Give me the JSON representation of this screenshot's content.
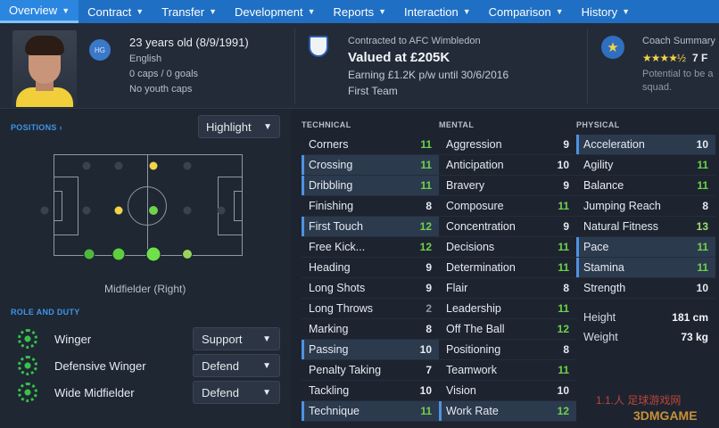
{
  "nav": [
    {
      "label": "Overview",
      "active": true
    },
    {
      "label": "Contract"
    },
    {
      "label": "Transfer"
    },
    {
      "label": "Development"
    },
    {
      "label": "Reports"
    },
    {
      "label": "Interaction"
    },
    {
      "label": "Comparison"
    },
    {
      "label": "History"
    }
  ],
  "bio": {
    "hg": "HG",
    "age": "23 years old (8/9/1991)",
    "nationality": "English",
    "caps": "0 caps / 0 goals",
    "youth": "No youth caps"
  },
  "contract": {
    "club_line": "Contracted to AFC Wimbledon",
    "valued": "Valued at £205K",
    "earning": "Earning £1.2K p/w until 30/6/2016",
    "squad": "First Team"
  },
  "coach": {
    "title": "Coach Summary",
    "stars": "★★★★½",
    "rating": "7 F",
    "desc1": "Potential to be a",
    "desc2": "squad."
  },
  "positions": {
    "label": "POSITIONS ›",
    "highlight": "Highlight",
    "caption": "Midfielder (Right)"
  },
  "role_duty": {
    "label": "ROLE AND DUTY",
    "roles": [
      {
        "name": "Winger",
        "duty": "Support"
      },
      {
        "name": "Defensive Winger",
        "duty": "Defend"
      },
      {
        "name": "Wide Midfielder",
        "duty": "Defend"
      }
    ]
  },
  "technical": {
    "header": "TECHNICAL",
    "attributes": [
      {
        "name": "Corners",
        "value": "11"
      },
      {
        "name": "Crossing",
        "value": "11"
      },
      {
        "name": "Dribbling",
        "value": "11"
      },
      {
        "name": "Finishing",
        "value": "8"
      },
      {
        "name": "First Touch",
        "value": "12"
      },
      {
        "name": "Free Kick...",
        "value": "12"
      },
      {
        "name": "Heading",
        "value": "9"
      },
      {
        "name": "Long Shots",
        "value": "9"
      },
      {
        "name": "Long Throws",
        "value": "2"
      },
      {
        "name": "Marking",
        "value": "8"
      },
      {
        "name": "Passing",
        "value": "10"
      },
      {
        "name": "Penalty Taking",
        "value": "7"
      },
      {
        "name": "Tackling",
        "value": "10"
      },
      {
        "name": "Technique",
        "value": "11"
      }
    ]
  },
  "mental": {
    "header": "MENTAL",
    "attributes": [
      {
        "name": "Aggression",
        "value": "9"
      },
      {
        "name": "Anticipation",
        "value": "10"
      },
      {
        "name": "Bravery",
        "value": "9"
      },
      {
        "name": "Composure",
        "value": "11"
      },
      {
        "name": "Concentration",
        "value": "9"
      },
      {
        "name": "Decisions",
        "value": "11"
      },
      {
        "name": "Determination",
        "value": "11"
      },
      {
        "name": "Flair",
        "value": "8"
      },
      {
        "name": "Leadership",
        "value": "11"
      },
      {
        "name": "Off The Ball",
        "value": "12"
      },
      {
        "name": "Positioning",
        "value": "8"
      },
      {
        "name": "Teamwork",
        "value": "11"
      },
      {
        "name": "Vision",
        "value": "10"
      },
      {
        "name": "Work Rate",
        "value": "12"
      }
    ]
  },
  "physical": {
    "header": "PHYSICAL",
    "attributes": [
      {
        "name": "Acceleration",
        "value": "10"
      },
      {
        "name": "Agility",
        "value": "11"
      },
      {
        "name": "Balance",
        "value": "11"
      },
      {
        "name": "Jumping Reach",
        "value": "8"
      },
      {
        "name": "Natural Fitness",
        "value": "13"
      },
      {
        "name": "Pace",
        "value": "11"
      },
      {
        "name": "Stamina",
        "value": "11"
      },
      {
        "name": "Strength",
        "value": "10"
      }
    ],
    "height_label": "Height",
    "height": "181 cm",
    "weight_label": "Weight",
    "weight": "73 kg"
  },
  "watermark": "1.1.人 足球游戏网",
  "watermark2": "3DMGAME",
  "colors": {
    "green": "#6fd24a",
    "lightgreen": "#9be06a",
    "grey": "#8f98a4",
    "white": "#e6eaf0",
    "yellow": "#f3d347"
  }
}
